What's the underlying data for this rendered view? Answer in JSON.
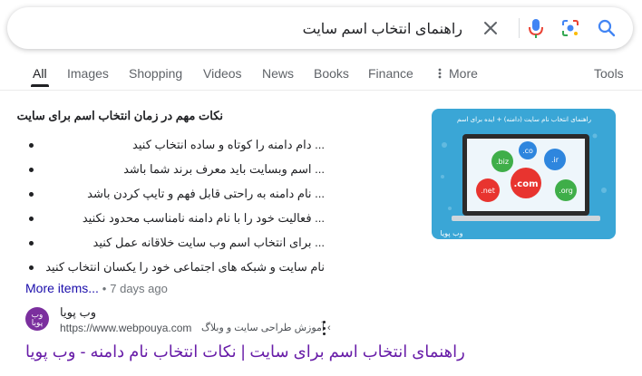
{
  "search": {
    "query": "راهنمای انتخاب اسم سایت"
  },
  "tabs": [
    {
      "label": "All",
      "active": true
    },
    {
      "label": "Images"
    },
    {
      "label": "Shopping"
    },
    {
      "label": "Videos"
    },
    {
      "label": "News"
    },
    {
      "label": "Books"
    },
    {
      "label": "Finance"
    },
    {
      "label": "More"
    },
    {
      "label": "Tools"
    }
  ],
  "snippet": {
    "title": "نکات مهم در زمان انتخاب اسم برای سایت",
    "items": [
      "... دام دامنه را کوتاه و ساده انتخاب کنید",
      "... اسم وبسایت باید معرف برند شما باشد",
      "... نام دامنه به راحتی قابل فهم و تایپ کردن باشد",
      "... فعالیت خود را با نام دامنه نامناسب محدود نکنید",
      "... برای انتخاب اسم وب سایت خلاقانه عمل کنید",
      "نام سایت و شبکه های اجتماعی خود را یکسان انتخاب کنید"
    ],
    "more_label": "More items...",
    "separator": "•",
    "date": "7 days ago"
  },
  "thumbnail": {
    "banner": "راهنمای انتخاب نام سایت (دامنه) + ایده برای اسم",
    "domains": [
      ".co",
      ".ir",
      ".biz",
      ".com",
      ".net",
      ".org"
    ],
    "watermark": "وب پویا"
  },
  "source": {
    "logo_text": "وب پویا",
    "name": "وب پویا",
    "url": "https://www.webpouya.com",
    "path": "› آموزش طراحی سایت و وبلاگ"
  },
  "result": {
    "title": "راهنمای انتخاب اسم برای سایت | نکات انتخاب نام دامنه - وب پویا"
  },
  "colors": {
    "link_blue": "#1a0dab",
    "visited_purple": "#681da8",
    "thumb_bg": "#3aa6d6",
    "logo_purple": "#7b2f9e"
  }
}
